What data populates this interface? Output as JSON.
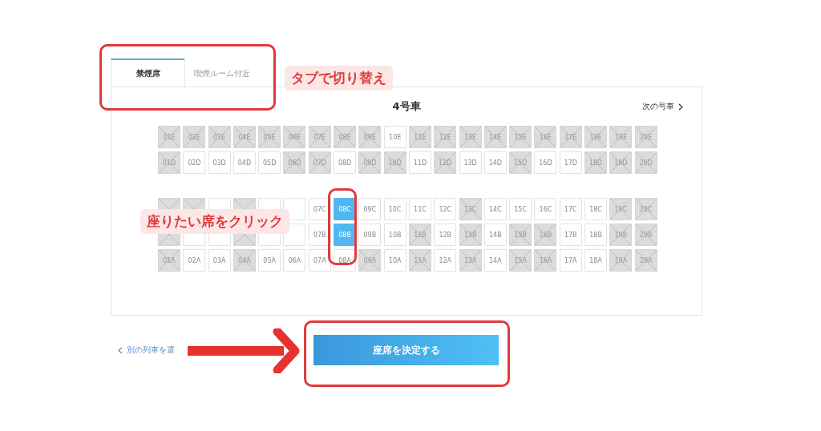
{
  "tabs": [
    {
      "label": "禁煙席",
      "selected": true
    },
    {
      "label": "喫煙ルーム付近",
      "selected": false
    }
  ],
  "car_nav": {
    "title": "4号車",
    "next": {
      "label": "次の号車",
      "disabled": false
    }
  },
  "seat_rows": [
    {
      "seats": [
        {
          "label": "01E",
          "taken": true,
          "selected": false
        },
        {
          "label": "02E",
          "taken": true,
          "selected": false
        },
        {
          "label": "03E",
          "taken": true,
          "selected": false
        },
        {
          "label": "04E",
          "taken": true,
          "selected": false
        },
        {
          "label": "05E",
          "taken": true,
          "selected": false
        },
        {
          "label": "06E",
          "taken": true,
          "selected": false
        },
        {
          "label": "07E",
          "taken": true,
          "selected": false
        },
        {
          "label": "08E",
          "taken": true,
          "selected": false
        },
        {
          "label": "09E",
          "taken": true,
          "selected": false
        },
        {
          "label": "10E",
          "taken": false,
          "selected": false
        },
        {
          "label": "11E",
          "taken": true,
          "selected": false
        },
        {
          "label": "12E",
          "taken": true,
          "selected": false
        },
        {
          "label": "13E",
          "taken": true,
          "selected": false
        },
        {
          "label": "14E",
          "taken": true,
          "selected": false
        },
        {
          "label": "15E",
          "taken": true,
          "selected": false
        },
        {
          "label": "16E",
          "taken": true,
          "selected": false
        },
        {
          "label": "17E",
          "taken": true,
          "selected": false
        },
        {
          "label": "18E",
          "taken": true,
          "selected": false
        },
        {
          "label": "19E",
          "taken": true,
          "selected": false
        },
        {
          "label": "20E",
          "taken": true,
          "selected": false
        }
      ]
    },
    {
      "seats": [
        {
          "label": "01D",
          "taken": true,
          "selected": false
        },
        {
          "label": "02D",
          "taken": false,
          "selected": false
        },
        {
          "label": "03D",
          "taken": false,
          "selected": false
        },
        {
          "label": "04D",
          "taken": false,
          "selected": false
        },
        {
          "label": "05D",
          "taken": false,
          "selected": false
        },
        {
          "label": "06D",
          "taken": true,
          "selected": false
        },
        {
          "label": "07D",
          "taken": true,
          "selected": false
        },
        {
          "label": "08D",
          "taken": false,
          "selected": false
        },
        {
          "label": "09D",
          "taken": true,
          "selected": false
        },
        {
          "label": "10D",
          "taken": true,
          "selected": false
        },
        {
          "label": "11D",
          "taken": false,
          "selected": false
        },
        {
          "label": "12D",
          "taken": true,
          "selected": false
        },
        {
          "label": "13D",
          "taken": false,
          "selected": false
        },
        {
          "label": "14D",
          "taken": false,
          "selected": false
        },
        {
          "label": "15D",
          "taken": true,
          "selected": false
        },
        {
          "label": "16D",
          "taken": false,
          "selected": false
        },
        {
          "label": "17D",
          "taken": false,
          "selected": false
        },
        {
          "label": "18D",
          "taken": true,
          "selected": false
        },
        {
          "label": "19D",
          "taken": true,
          "selected": false
        },
        {
          "label": "20D",
          "taken": true,
          "selected": false
        }
      ]
    },
    {
      "seats": [
        {
          "taken": true,
          "selected": false
        },
        {
          "taken": true,
          "selected": false
        },
        {
          "taken": false,
          "selected": false
        },
        {
          "taken": true,
          "selected": false
        },
        {
          "taken": false,
          "selected": false
        },
        {
          "taken": false,
          "selected": false
        },
        {
          "label": "07C",
          "taken": false,
          "selected": false
        },
        {
          "label": "08C",
          "taken": false,
          "selected": true
        },
        {
          "label": "09C",
          "taken": false,
          "selected": false
        },
        {
          "label": "10C",
          "taken": false,
          "selected": false
        },
        {
          "label": "11C",
          "taken": false,
          "selected": false
        },
        {
          "label": "12C",
          "taken": false,
          "selected": false
        },
        {
          "label": "13C",
          "taken": true,
          "selected": false
        },
        {
          "label": "14C",
          "taken": false,
          "selected": false
        },
        {
          "label": "15C",
          "taken": false,
          "selected": false
        },
        {
          "label": "16C",
          "taken": false,
          "selected": false
        },
        {
          "label": "17C",
          "taken": false,
          "selected": false
        },
        {
          "label": "18C",
          "taken": false,
          "selected": false
        },
        {
          "label": "19C",
          "taken": true,
          "selected": false
        },
        {
          "label": "20C",
          "taken": true,
          "selected": false
        }
      ]
    },
    {
      "seats": [
        {
          "taken": true,
          "selected": false
        },
        {
          "taken": false,
          "selected": false
        },
        {
          "taken": false,
          "selected": false
        },
        {
          "taken": true,
          "selected": false
        },
        {
          "taken": false,
          "selected": false
        },
        {
          "taken": false,
          "selected": false
        },
        {
          "label": "07B",
          "taken": false,
          "selected": false
        },
        {
          "label": "08B",
          "taken": false,
          "selected": true
        },
        {
          "label": "09B",
          "taken": false,
          "selected": false
        },
        {
          "label": "10B",
          "taken": false,
          "selected": false
        },
        {
          "label": "11B",
          "taken": true,
          "selected": false
        },
        {
          "label": "12B",
          "taken": false,
          "selected": false
        },
        {
          "label": "13B",
          "taken": true,
          "selected": false
        },
        {
          "label": "14B",
          "taken": false,
          "selected": false
        },
        {
          "label": "15B",
          "taken": true,
          "selected": false
        },
        {
          "label": "16B",
          "taken": true,
          "selected": false
        },
        {
          "label": "17B",
          "taken": false,
          "selected": false
        },
        {
          "label": "18B",
          "taken": false,
          "selected": false
        },
        {
          "label": "19B",
          "taken": true,
          "selected": false
        },
        {
          "label": "20B",
          "taken": true,
          "selected": false
        }
      ]
    },
    {
      "seats": [
        {
          "label": "01A",
          "taken": true,
          "selected": false
        },
        {
          "label": "02A",
          "taken": false,
          "selected": false
        },
        {
          "label": "03A",
          "taken": false,
          "selected": false
        },
        {
          "label": "04A",
          "taken": true,
          "selected": false
        },
        {
          "label": "05A",
          "taken": false,
          "selected": false
        },
        {
          "label": "06A",
          "taken": false,
          "selected": false
        },
        {
          "label": "07A",
          "taken": false,
          "selected": false
        },
        {
          "label": "08A",
          "taken": false,
          "selected": false
        },
        {
          "label": "09A",
          "taken": true,
          "selected": false
        },
        {
          "label": "10A",
          "taken": false,
          "selected": false
        },
        {
          "label": "11A",
          "taken": true,
          "selected": false
        },
        {
          "label": "12A",
          "taken": false,
          "selected": false
        },
        {
          "label": "13A",
          "taken": true,
          "selected": false
        },
        {
          "label": "14A",
          "taken": false,
          "selected": false
        },
        {
          "label": "15A",
          "taken": true,
          "selected": false
        },
        {
          "label": "16A",
          "taken": true,
          "selected": false
        },
        {
          "label": "17A",
          "taken": false,
          "selected": false
        },
        {
          "label": "18A",
          "taken": false,
          "selected": false
        },
        {
          "label": "19A",
          "taken": true,
          "selected": false
        },
        {
          "label": "20A",
          "taken": true,
          "selected": false
        }
      ]
    }
  ],
  "back_link": "別の列車を選",
  "confirm_button": "座席を決定する",
  "annotations": [
    {
      "text": "タブで切り替え"
    },
    {
      "text": "座りたい席をクリック"
    }
  ]
}
